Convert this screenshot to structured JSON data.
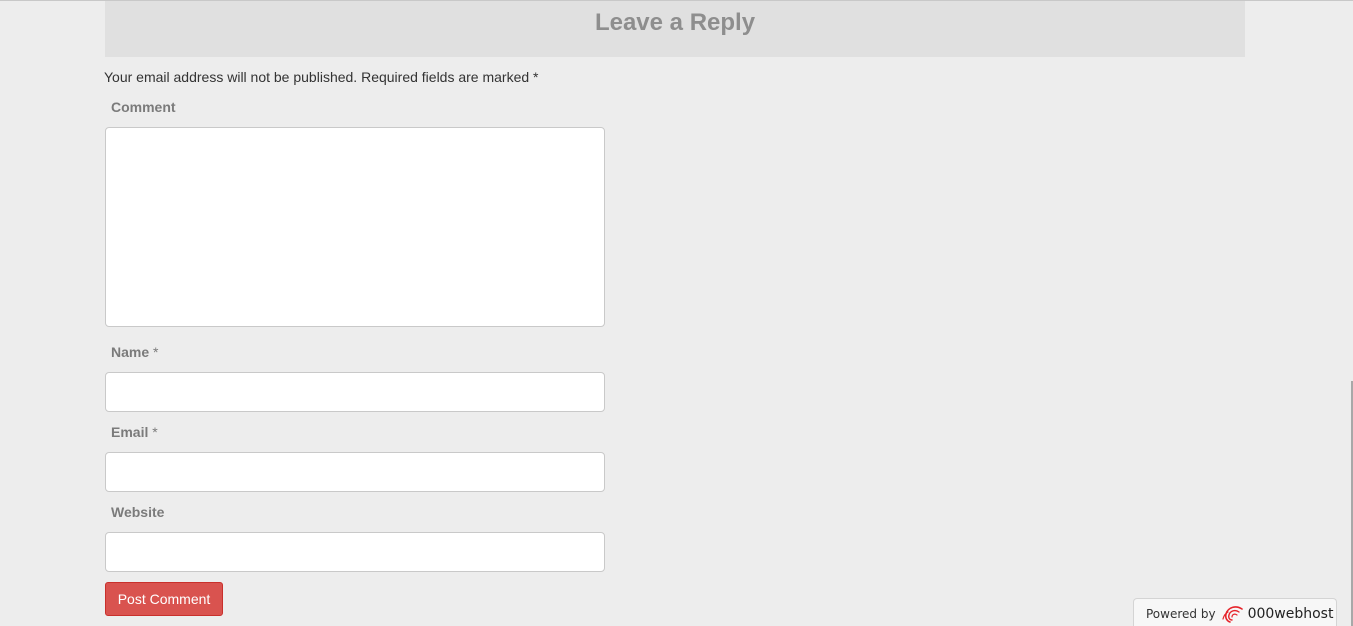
{
  "reply": {
    "title": "Leave a Reply",
    "notes": "Your email address will not be published. Required fields are marked *"
  },
  "form": {
    "comment_label": "Comment",
    "name_label": "Name",
    "email_label": "Email",
    "website_label": "Website",
    "required_mark": "*",
    "comment_value": "",
    "name_value": "",
    "email_value": "",
    "website_value": "",
    "submit_label": "Post Comment"
  },
  "footer": {
    "powered_by": "Powered by",
    "host_name": "000webhost",
    "logo_icon": "swirl-logo-icon"
  },
  "colors": {
    "background": "#ededed",
    "header_band": "#e0e0e0",
    "submit_button": "#d9534f",
    "logo_red": "#e6242b"
  }
}
